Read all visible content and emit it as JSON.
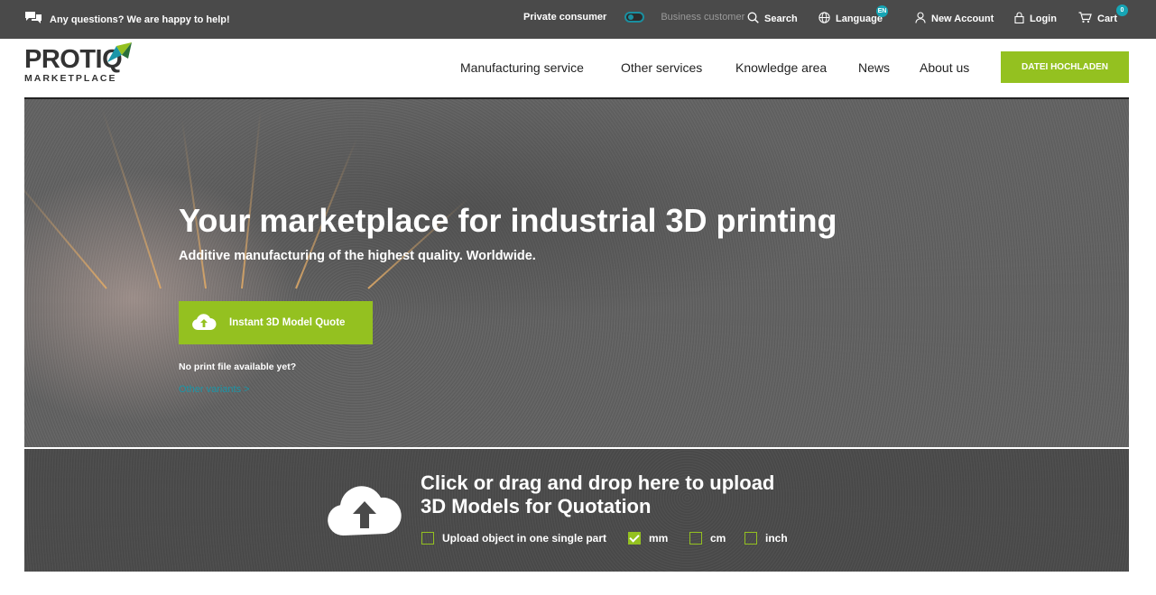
{
  "topbar": {
    "help_text": "Any questions? We are happy to help!",
    "private_label": "Private consumer",
    "business_label": "Business customer",
    "search_label": "Search",
    "language_label": "Language",
    "language_badge": "EN",
    "new_account_label": "New Account",
    "login_label": "Login",
    "cart_label": "Cart",
    "cart_count": "0"
  },
  "header": {
    "logo_brand": "PROTIQ",
    "logo_sub": "MARKETPLACE",
    "nav": [
      "Manufacturing service",
      "Other services",
      "Knowledge area",
      "News",
      "About us"
    ],
    "cta_label": "DATEI HOCHLADEN"
  },
  "hero": {
    "title": "Your marketplace for industrial 3D printing",
    "subtitle": "Additive manufacturing of the highest quality. Worldwide.",
    "quote_button": "Instant 3D Model Quote",
    "no_file_text": "No print file available yet?",
    "link_text": "Other variants >"
  },
  "upload": {
    "title_line1": "Click or drag and drop here to upload",
    "title_line2": "3D Models for Quotation",
    "options": [
      {
        "label": "Upload object in one single part",
        "checked": false
      },
      {
        "label": "mm",
        "checked": true
      },
      {
        "label": "cm",
        "checked": false
      },
      {
        "label": "inch",
        "checked": false
      }
    ]
  },
  "colors": {
    "accent": "#94c120",
    "teal": "#16a5b5",
    "topbar": "#4a4a4a"
  }
}
